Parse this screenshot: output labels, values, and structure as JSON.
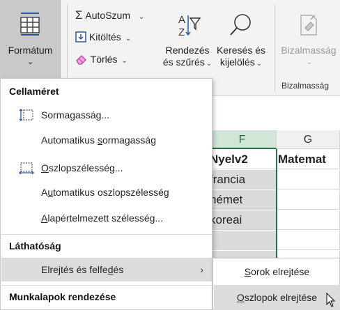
{
  "ribbon": {
    "formatum": {
      "label": "Formátum",
      "chevron": "⌄"
    },
    "autosum": "AutoSzum",
    "fill": "Kitöltés",
    "clear": "Törlés",
    "sort_line1": "Rendezés",
    "sort_line2": "és szűrés",
    "find_line1": "Keresés és",
    "find_line2": "kijelölés",
    "sensitivity": "Bizalmasság",
    "sensitivity_group": "Bizalmasság",
    "colors": {
      "ribbon_bg": "#f3f3f3",
      "pressed_bg": "#c9c9c9",
      "icon_blue": "#2b579a",
      "icon_purple": "#c23fa7"
    }
  },
  "sheet": {
    "col_f": "F",
    "col_g": "G",
    "f_cells": [
      "Nyelv2",
      "francia",
      "német",
      "koreai",
      "",
      "",
      ""
    ],
    "g_cells": [
      "Matemat",
      "",
      "",
      "",
      "",
      "",
      ""
    ],
    "selection_color": "#217346"
  },
  "menu": {
    "section_cell_size": "Cellaméret",
    "row_height_pre": "Sorma",
    "row_height_u": "g",
    "row_height_post": "asság...",
    "auto_row_pre": "Automatikus ",
    "auto_row_u": "s",
    "auto_row_post": "ormagasság",
    "col_width_u": "O",
    "col_width_post": "szlopszélesség...",
    "auto_col_pre": "A",
    "auto_col_u": "u",
    "auto_col_post": "tomatikus oszlopszélesség",
    "default_width_u": "A",
    "default_width_post": "lapértelmezett szélesség...",
    "section_visibility": "Láthatóság",
    "hide_show_pre": "Elrejtés és felfe",
    "hide_show_u": "d",
    "hide_show_post": "és",
    "hide_show_arrow": "›",
    "section_arrange": "Munkalapok rendezése"
  },
  "submenu": {
    "hide_rows_u": "S",
    "hide_rows_post": "orok elrejtése",
    "hide_cols_u": "O",
    "hide_cols_post": "szlopok elrejtése"
  }
}
